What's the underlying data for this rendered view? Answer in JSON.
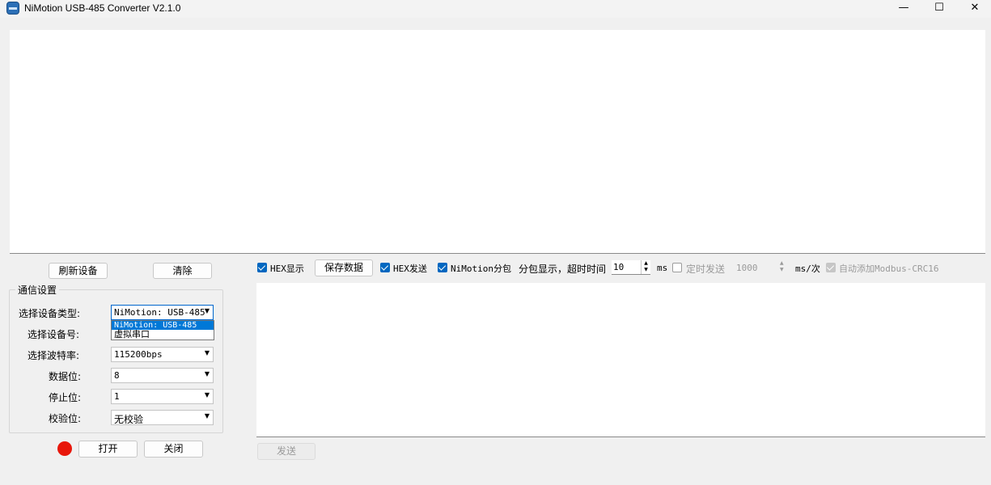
{
  "window": {
    "title": "NiMotion USB-485 Converter V2.1.0",
    "minimize_glyph": "—",
    "maximize_glyph": "☐",
    "close_glyph": "✕"
  },
  "left": {
    "refresh_button": "刷新设备",
    "clear_button": "清除",
    "group_title": "通信设置",
    "labels": {
      "device_type": "选择设备类型:",
      "device_no": "选择设备号:",
      "baud": "选择波特率:",
      "data_bits": "数据位:",
      "stop_bits": "停止位:",
      "parity": "校验位:"
    },
    "values": {
      "device_type": "NiMotion: USB-485",
      "baud": "115200bps",
      "data_bits": "8",
      "stop_bits": "1",
      "parity": "无校验"
    },
    "device_type_options": [
      "NiMotion: USB-485",
      "虚拟串口"
    ],
    "open_button": "打开",
    "close_button": "关闭",
    "status_color": "#e8170b"
  },
  "toolbar": {
    "hex_display": "HEX显示",
    "save_data": "保存数据",
    "hex_send": "HEX发送",
    "nimotion_packet": "NiMotion分包",
    "packet_timeout_label": "分包显示，超时时间",
    "timeout_value": "10",
    "timeout_unit": "ms",
    "timed_send": "定时发送",
    "interval_value": "1000",
    "interval_unit": "ms/次",
    "auto_crc": "自动添加Modbus-CRC16"
  },
  "send_button": "发送"
}
